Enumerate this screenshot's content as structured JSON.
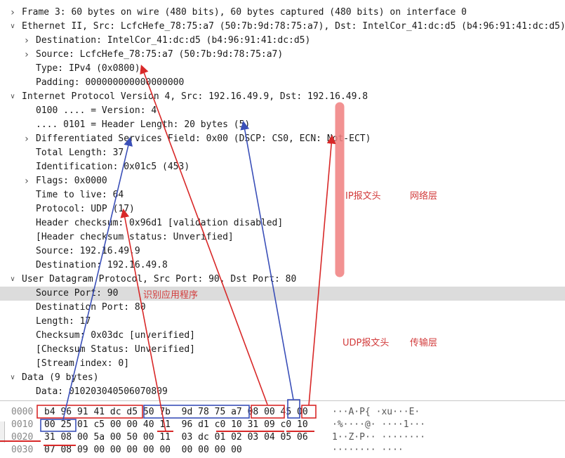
{
  "tree": [
    {
      "text": "Frame 3: 60 bytes on wire (480 bits), 60 bytes captured (480 bits) on interface 0",
      "indent": 0,
      "arrow": "collapsed"
    },
    {
      "text": "Ethernet II, Src: LcfcHefe_78:75:a7 (50:7b:9d:78:75:a7), Dst: IntelCor_41:dc:d5 (b4:96:91:41:dc:d5)",
      "indent": 0,
      "arrow": "expanded"
    },
    {
      "text": "Destination: IntelCor_41:dc:d5 (b4:96:91:41:dc:d5)",
      "indent": 1,
      "arrow": "collapsed"
    },
    {
      "text": "Source: LcfcHefe_78:75:a7 (50:7b:9d:78:75:a7)",
      "indent": 1,
      "arrow": "collapsed"
    },
    {
      "text": "Type: IPv4 (0x0800)",
      "indent": 1,
      "arrow": "none"
    },
    {
      "text": "Padding: 000000000000000000",
      "indent": 1,
      "arrow": "none"
    },
    {
      "text": "Internet Protocol Version 4, Src: 192.16.49.9, Dst: 192.16.49.8",
      "indent": 0,
      "arrow": "expanded"
    },
    {
      "text": "0100 .... = Version: 4",
      "indent": 1,
      "arrow": "none"
    },
    {
      "text": ".... 0101 = Header Length: 20 bytes (5)",
      "indent": 1,
      "arrow": "none"
    },
    {
      "text": "Differentiated Services Field: 0x00 (DSCP: CS0, ECN: Not-ECT)",
      "indent": 1,
      "arrow": "collapsed"
    },
    {
      "text": "Total Length: 37",
      "indent": 1,
      "arrow": "none"
    },
    {
      "text": "Identification: 0x01c5 (453)",
      "indent": 1,
      "arrow": "none"
    },
    {
      "text": "Flags: 0x0000",
      "indent": 1,
      "arrow": "collapsed"
    },
    {
      "text": "Time to live: 64",
      "indent": 1,
      "arrow": "none"
    },
    {
      "text": "Protocol: UDP (17)",
      "indent": 1,
      "arrow": "none"
    },
    {
      "text": "Header checksum: 0x96d1 [validation disabled]",
      "indent": 1,
      "arrow": "none"
    },
    {
      "text": "[Header checksum status: Unverified]",
      "indent": 1,
      "arrow": "none"
    },
    {
      "text": "Source: 192.16.49.9",
      "indent": 1,
      "arrow": "none"
    },
    {
      "text": "Destination: 192.16.49.8",
      "indent": 1,
      "arrow": "none"
    },
    {
      "text": "User Datagram Protocol, Src Port: 90, Dst Port: 80",
      "indent": 0,
      "arrow": "expanded"
    },
    {
      "text": "Source Port: 90",
      "indent": 1,
      "arrow": "none",
      "selected": true
    },
    {
      "text": "Destination Port: 80",
      "indent": 1,
      "arrow": "none"
    },
    {
      "text": "Length: 17",
      "indent": 1,
      "arrow": "none"
    },
    {
      "text": "Checksum: 0x03dc [unverified]",
      "indent": 1,
      "arrow": "none"
    },
    {
      "text": "[Checksum Status: Unverified]",
      "indent": 1,
      "arrow": "none"
    },
    {
      "text": "[Stream index: 0]",
      "indent": 1,
      "arrow": "none"
    },
    {
      "text": "Data (9 bytes)",
      "indent": 0,
      "arrow": "expanded"
    },
    {
      "text": "Data: 010203040506070809",
      "indent": 1,
      "arrow": "none"
    }
  ],
  "hex": [
    {
      "offset": "0000",
      "bytes": "b4 96 91 41 dc d5 50 7b  9d 78 75 a7 08 00 45 00",
      "ascii": "···A·P{ ·xu···E·"
    },
    {
      "offset": "0010",
      "bytes": "00 25 01 c5 00 00 40 11  96 d1 c0 10 31 09 c0 10",
      "ascii": "·%····@· ····1···"
    },
    {
      "offset": "0020",
      "bytes": "31 08 00 5a 00 50 00 11  03 dc 01 02 03 04 05 06",
      "ascii": "1··Z·P·· ········"
    },
    {
      "offset": "0030",
      "bytes": "07 08 09 00 00 00 00 00  00 00 00 00",
      "ascii": "········ ····"
    }
  ],
  "annotations": {
    "ip_header": "IP报文头",
    "network_layer": "网络层",
    "identify_app": "识别应用程序",
    "udp_header": "UDP报文头",
    "transport_layer": "传输层"
  },
  "colors": {
    "red_mark": "#d82828",
    "blue_mark": "#3a4fb8",
    "highlight_bar": "#f08080",
    "selection": "#dcdcdc"
  }
}
